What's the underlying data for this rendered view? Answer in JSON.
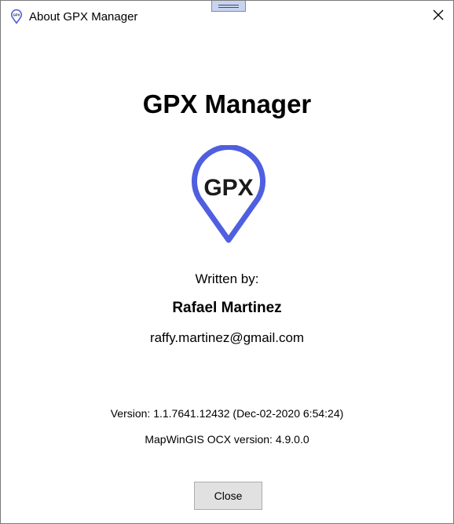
{
  "window": {
    "title": "About GPX Manager"
  },
  "main": {
    "app_title": "GPX Manager",
    "logo_text": "GPX",
    "written_by_label": "Written by:",
    "author": "Rafael Martinez",
    "email": "raffy.martinez@gmail.com",
    "version": "Version: 1.1.7641.12432 (Dec-02-2020 6:54:24)",
    "ocx_version": "MapWinGIS OCX version: 4.9.0.0"
  },
  "footer": {
    "close_label": "Close"
  },
  "icons": {
    "title_icon": "gpx-pin-icon",
    "close_icon": "close-icon",
    "logo": "gpx-pin-logo"
  },
  "colors": {
    "accent": "#4f5fe0",
    "button_bg": "#e1e1e1",
    "button_border": "#adadad"
  }
}
